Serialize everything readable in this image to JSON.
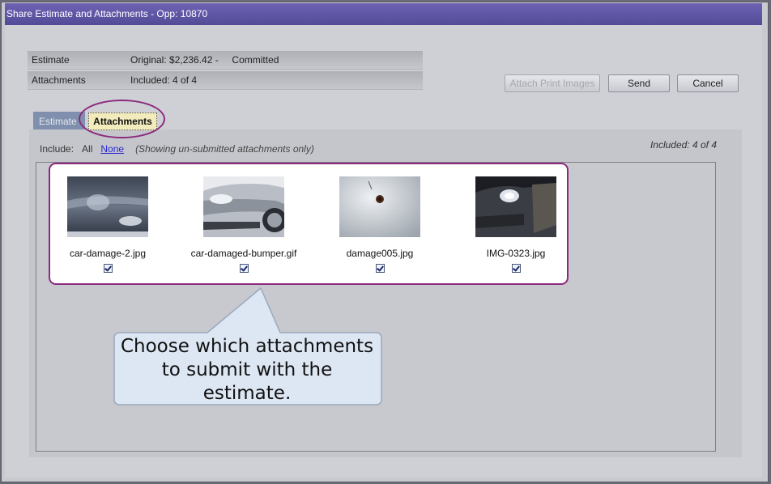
{
  "window": {
    "title": "Share Estimate and Attachments - Opp: 10870"
  },
  "summary": {
    "estimate_label": "Estimate",
    "estimate_value": "Original: $2,236.42 -     Committed",
    "attachments_label": "Attachments",
    "attachments_value": "Included: 4 of 4"
  },
  "buttons": {
    "attach_print_images": "Attach Print Images",
    "send": "Send",
    "cancel": "Cancel"
  },
  "tabs": [
    {
      "label": "Estimates",
      "visible_label": "Estimate",
      "active": false
    },
    {
      "label": "Attachments",
      "active": true
    }
  ],
  "filter": {
    "include_label": "Include:",
    "all_link": "All",
    "none_link": "None",
    "showing_note": "(Showing un-submitted attachments only)",
    "included_count": "Included: 4 of 4"
  },
  "attachments": [
    {
      "filename": "car-damage-2.jpg",
      "checked": true,
      "icon": "car-door-dent-photo"
    },
    {
      "filename": "car-damaged-bumper.gif",
      "checked": true,
      "icon": "car-bumper-photo"
    },
    {
      "filename": "damage005.jpg",
      "checked": true,
      "icon": "panel-hole-photo"
    },
    {
      "filename": "IMG-0323.jpg",
      "checked": true,
      "icon": "car-headlight-photo"
    }
  ],
  "callout": {
    "line1": "Choose which attachments",
    "line2": "to submit with the",
    "line3": "estimate."
  },
  "colors": {
    "titlebar": "#5d54a3",
    "highlight_ring": "#8b2a7e",
    "active_tab": "#f2ebbb",
    "inactive_tab": "#7f8fad",
    "link": "#2a2ad0"
  }
}
